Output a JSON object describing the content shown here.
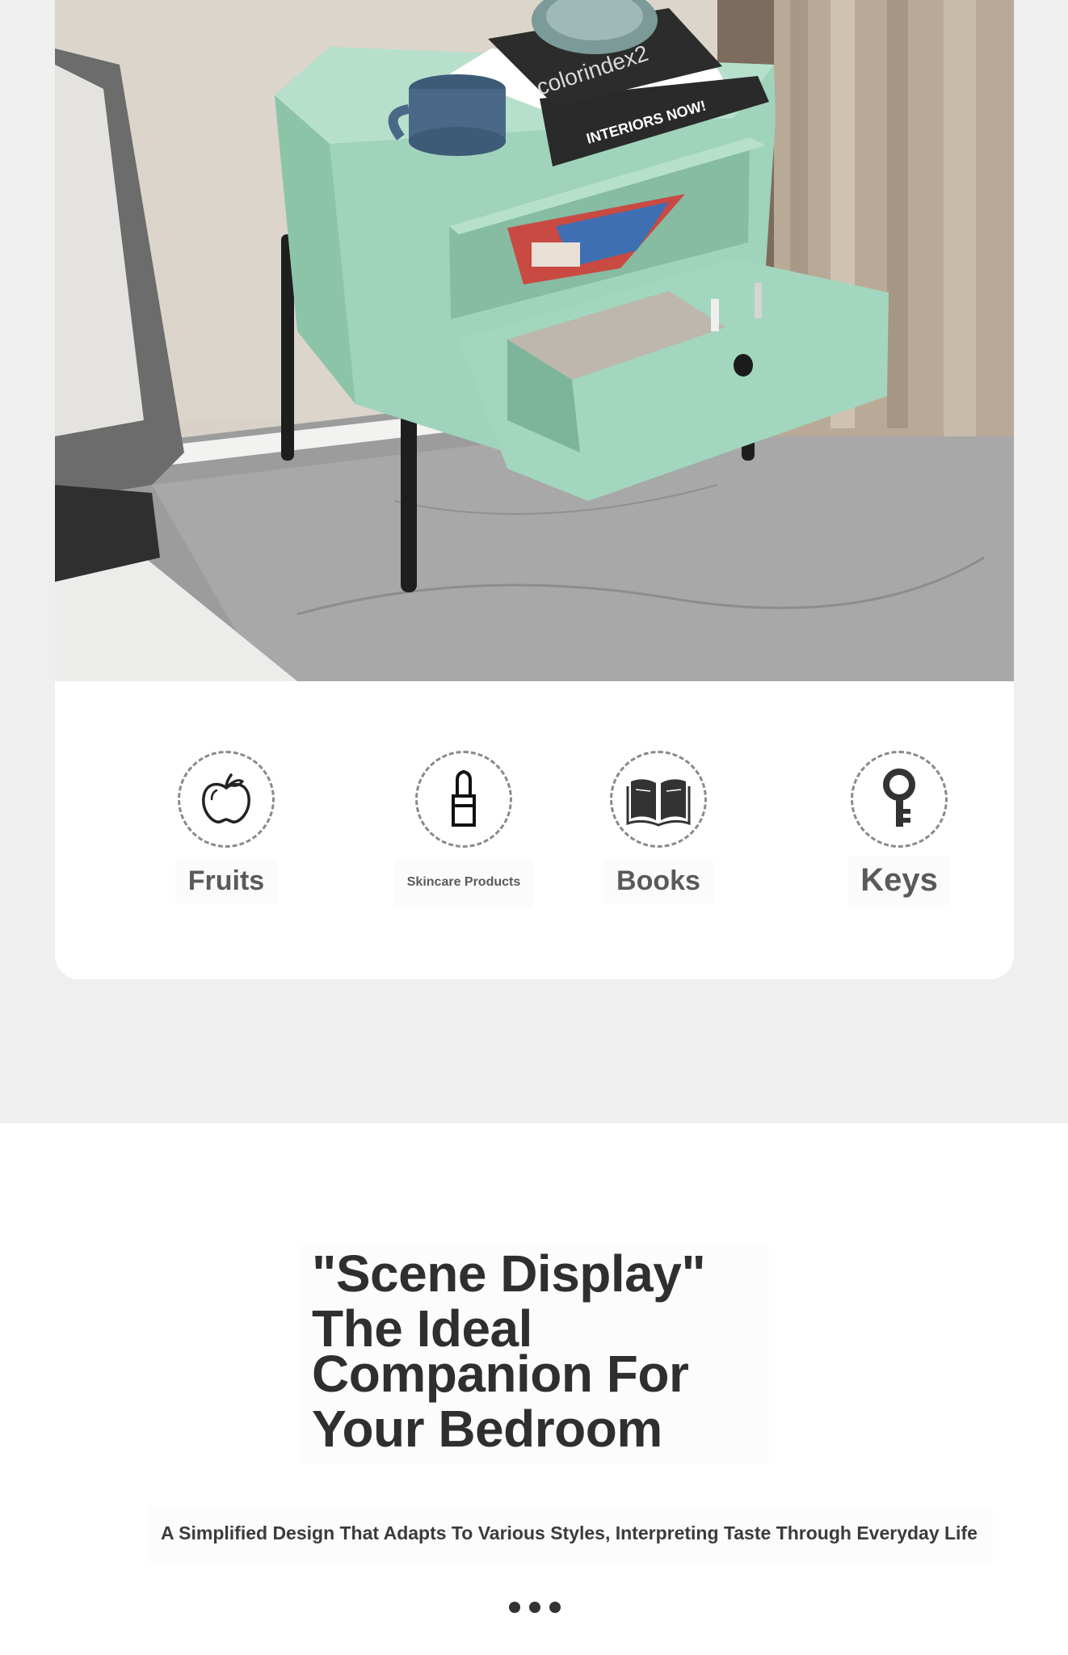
{
  "scene_photo": {
    "book_text_1": "colorindex2",
    "book_text_2": "INTERIORS NOW!"
  },
  "uses": [
    {
      "icon": "apple-icon",
      "label": "Fruits"
    },
    {
      "icon": "lipstick-icon",
      "label": "Skincare Products"
    },
    {
      "icon": "open-book-icon",
      "label": "Books"
    },
    {
      "icon": "key-icon",
      "label": "Keys"
    }
  ],
  "headline": {
    "line1": "\"Scene Display\"",
    "line2": "The Ideal",
    "line3": "Companion For",
    "line4": "Your Bedroom"
  },
  "subline": "A Simplified Design That Adapts To Various Styles, Interpreting Taste Through Everyday Life",
  "colors": {
    "page_background": "#efefef",
    "card_background": "#ffffff",
    "cabinet_green": "#9fd3bb",
    "text_dark": "#2f2f2f",
    "label_gray": "#5a5a5a"
  }
}
